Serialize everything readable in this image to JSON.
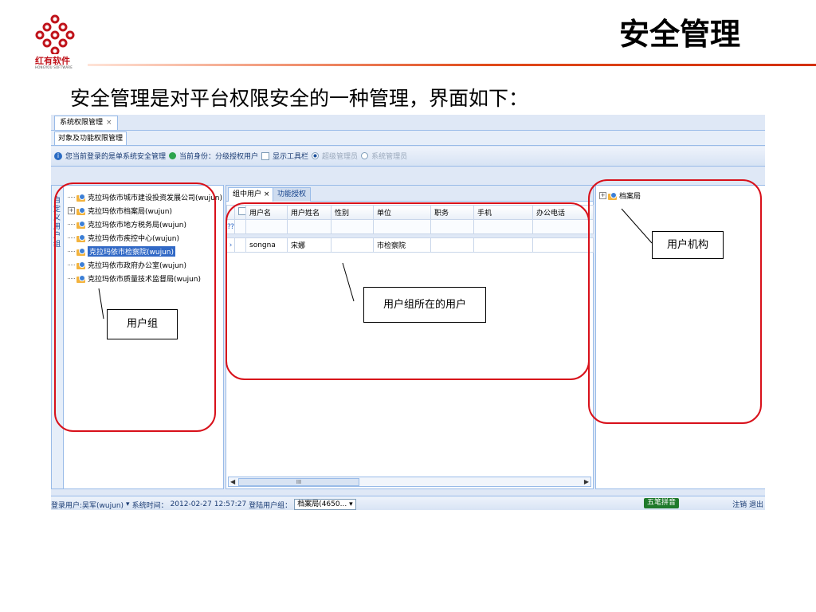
{
  "slide": {
    "logo_cn": "红有软件",
    "logo_en": "HONGYOU SOFTWARE",
    "title": "安全管理",
    "intro": "安全管理是对平台权限安全的一种管理，界面如下："
  },
  "app": {
    "window_tab": "系统权限管理",
    "window_tab_close": "×",
    "sub_tab": "对象及功能权限管理",
    "toolbar": {
      "info_text": "您当前登录的是单系统安全管理",
      "role_text": "当前身份：分级授权用户",
      "show_toolbar_label": "显示工具栏",
      "radio_super": "超级管理员",
      "radio_system": "系统管理员"
    },
    "left_panel": {
      "vertical_tab_label": "自定义用户组",
      "tree": [
        {
          "label": "克拉玛依市城市建设投资发展公司(wujun)",
          "expander": "",
          "selected": false
        },
        {
          "label": "克拉玛依市档案局(wujun)",
          "expander": "+",
          "selected": false
        },
        {
          "label": "克拉玛依市地方税务局(wujun)",
          "expander": "",
          "selected": false
        },
        {
          "label": "克拉玛依市疾控中心(wujun)",
          "expander": "",
          "selected": false
        },
        {
          "label": "克拉玛依市检察院(wujun)",
          "expander": "",
          "selected": true
        },
        {
          "label": "克拉玛依市政府办公室(wujun)",
          "expander": "",
          "selected": false
        },
        {
          "label": "克拉玛依市质量技术监督局(wujun)",
          "expander": "",
          "selected": false
        }
      ]
    },
    "mid_panel": {
      "tab_active": "组中用户",
      "tab_active_close": "×",
      "tab_inactive": "功能授权",
      "columns": [
        "用户名",
        "用户姓名",
        "性别",
        "单位",
        "职务",
        "手机",
        "办公电话"
      ],
      "rows": [
        [
          "songna",
          "宋娜",
          "",
          "市检察院",
          "",
          "",
          ""
        ]
      ],
      "scroll_thumb": "III"
    },
    "right_panel": {
      "tree_root": "档案局",
      "tree_root_expander": "+"
    },
    "statusbar": {
      "login_user": "登录用户:吴军(wujun)",
      "system_time_label": "系统时间：",
      "system_time": "2012-02-27 12:57:27",
      "login_group_label": "登陆用户组：",
      "login_group_value": "档案局(4650...",
      "ime": "五笔拼音",
      "logout": "注销 退出"
    }
  },
  "annotations": {
    "user_group": "用户组",
    "group_users": "用户组所在的用户",
    "user_org": "用户机构"
  },
  "colors": {
    "annotation_red": "#d8101a",
    "brand_red": "#c0141c",
    "selection_blue": "#3169c6",
    "panel_border": "#99bbe8"
  }
}
